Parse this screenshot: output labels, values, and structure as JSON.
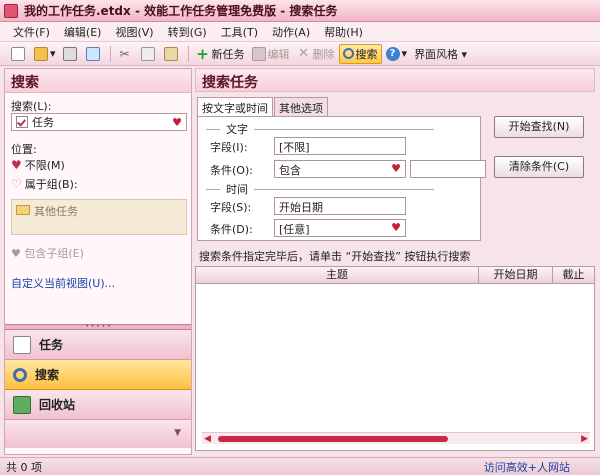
{
  "window": {
    "title": "我的工作任务.etdx - 效能工作任务管理免费版 - 搜索任务"
  },
  "menu": [
    "文件(F)",
    "编辑(E)",
    "视图(V)",
    "转到(G)",
    "工具(T)",
    "动作(A)",
    "帮助(H)"
  ],
  "toolbar": {
    "new_task": "新任务",
    "edit": "编辑",
    "delete": "删除",
    "search": "搜索",
    "theme": "界面风格 ▾"
  },
  "left": {
    "header": "搜索",
    "search_label": "搜索(L):",
    "search_value": "任务",
    "position_label": "位置:",
    "opt_unlimited": "不限(M)",
    "opt_group": "属于组(B):",
    "group_item": "其他任务",
    "include_sub": "包含子组(E)",
    "define_view": "自定义当前视图(U)...",
    "nav": [
      {
        "label": "任务"
      },
      {
        "label": "搜索"
      },
      {
        "label": "回收站"
      }
    ]
  },
  "right": {
    "header": "搜索任务",
    "tabs": [
      "按文字或时间",
      "其他选项"
    ],
    "section_text": "文字",
    "field_label": "字段(I):",
    "field_value": "[不限]",
    "cond_label": "条件(O):",
    "cond_value": "包含",
    "section_time": "时间",
    "time_field_label": "字段(S):",
    "time_field_value": "开始日期",
    "time_cond_label": "条件(D):",
    "time_cond_value": "[任意]",
    "btn_start": "开始查找(N)",
    "btn_clear": "清除条件(C)",
    "hint": "搜索条件指定完毕后，请单击 “开始查找” 按钮执行搜索",
    "columns": [
      "主题",
      "开始日期",
      "截止"
    ]
  },
  "status": {
    "count": "共 0 项",
    "link": "访问高效+人网站"
  }
}
